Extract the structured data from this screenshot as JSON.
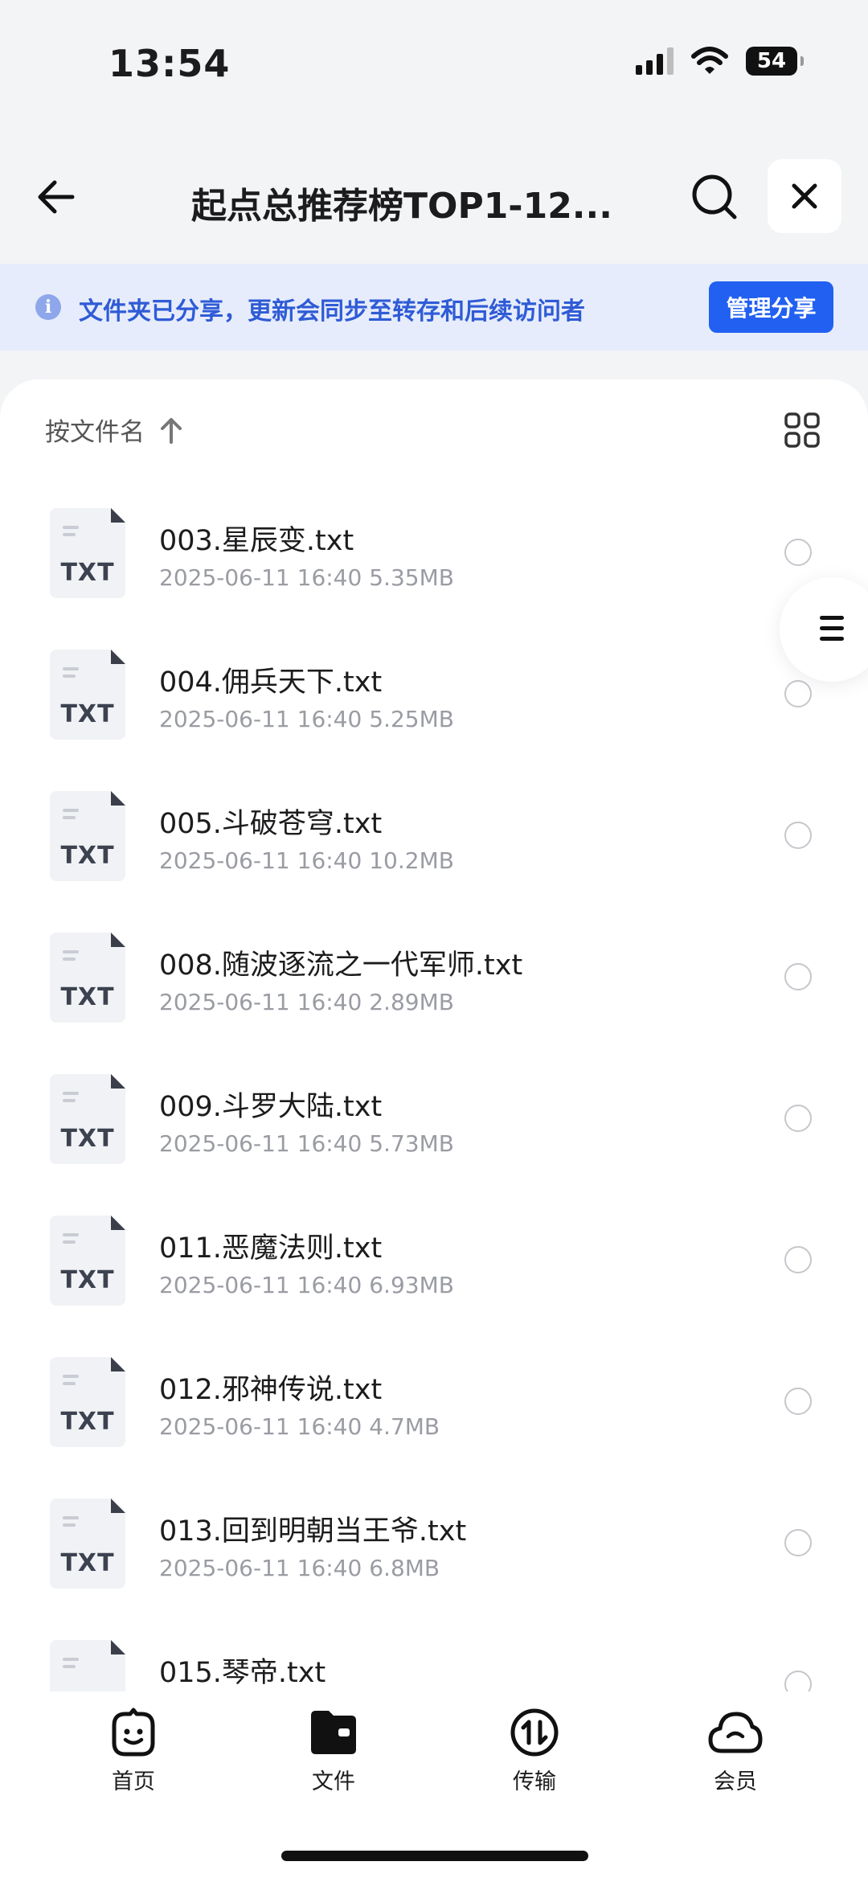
{
  "status_bar": {
    "time": "13:54",
    "battery": "54"
  },
  "nav": {
    "title": "起点总推荐榜TOP1-12..."
  },
  "share_banner": {
    "text": "文件夹已分享，更新会同步至转存和后续访问者",
    "button": "管理分享"
  },
  "sort": {
    "label": "按文件名"
  },
  "files": [
    {
      "name": "003.星辰变.txt",
      "date": "2025-06-11 16:40",
      "size": "5.35MB",
      "type": "TXT"
    },
    {
      "name": "004.佣兵天下.txt",
      "date": "2025-06-11 16:40",
      "size": "5.25MB",
      "type": "TXT"
    },
    {
      "name": "005.斗破苍穹.txt",
      "date": "2025-06-11 16:40",
      "size": "10.2MB",
      "type": "TXT"
    },
    {
      "name": "008.随波逐流之一代军师.txt",
      "date": "2025-06-11 16:40",
      "size": "2.89MB",
      "type": "TXT"
    },
    {
      "name": "009.斗罗大陆.txt",
      "date": "2025-06-11 16:40",
      "size": "5.73MB",
      "type": "TXT"
    },
    {
      "name": "011.恶魔法则.txt",
      "date": "2025-06-11 16:40",
      "size": "6.93MB",
      "type": "TXT"
    },
    {
      "name": "012.邪神传说.txt",
      "date": "2025-06-11 16:40",
      "size": "4.7MB",
      "type": "TXT"
    },
    {
      "name": "013.回到明朝当王爷.txt",
      "date": "2025-06-11 16:40",
      "size": "6.8MB",
      "type": "TXT"
    },
    {
      "name": "015.琴帝.txt",
      "date": "",
      "size": "",
      "type": ""
    }
  ],
  "tabs": [
    {
      "label": "首页",
      "icon": "smile-box-icon"
    },
    {
      "label": "文件",
      "icon": "folder-icon"
    },
    {
      "label": "传输",
      "icon": "transfer-icon"
    },
    {
      "label": "会员",
      "icon": "cloud-icon"
    }
  ],
  "colors": {
    "accent": "#2160f0",
    "banner_bg": "#e6ecfb",
    "banner_text": "#2f5bd6"
  }
}
